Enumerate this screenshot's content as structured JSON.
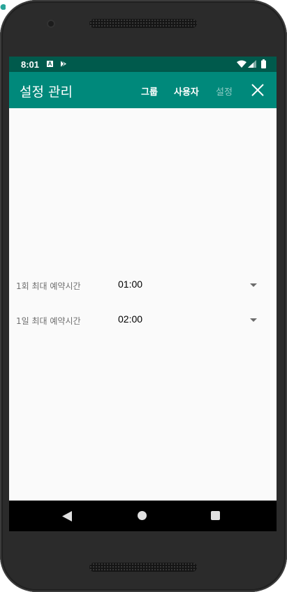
{
  "status_bar": {
    "time": "8:01",
    "notification_icons": [
      "a-icon",
      "play-store-icon"
    ],
    "system_icons": [
      "wifi-icon",
      "signal-icon",
      "battery-icon"
    ],
    "a_icon_glyph": "A"
  },
  "app_bar": {
    "title": "설정 관리",
    "tabs": [
      {
        "label": "그룹",
        "active": false
      },
      {
        "label": "사용자",
        "active": false
      },
      {
        "label": "설정",
        "active": true
      }
    ],
    "close_icon": "close-icon"
  },
  "settings": [
    {
      "label": "1회 최대 예약시간",
      "value": "01:00"
    },
    {
      "label": "1일 최대 예약시간",
      "value": "02:00"
    }
  ],
  "nav_bar": {
    "icons": [
      "back-icon",
      "home-icon",
      "recents-icon"
    ]
  },
  "colors": {
    "status_bar": "#005a4c",
    "app_bar": "#00897b",
    "background": "#fafafa",
    "label_text": "#6f6f6f",
    "value_text": "#000000",
    "phone_frame": "#2b2b2b"
  }
}
